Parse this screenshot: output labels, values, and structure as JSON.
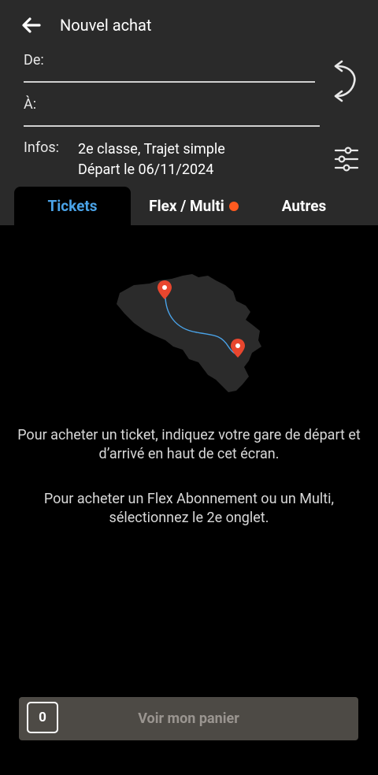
{
  "header": {
    "title": "Nouvel achat",
    "back_icon": "arrow-left-icon"
  },
  "form": {
    "from_label": "De:",
    "from_value": "",
    "to_label": "À:",
    "to_value": "",
    "swap_icon": "swap-direction-icon"
  },
  "infos": {
    "label": "Infos:",
    "line1": "2e classe, Trajet simple",
    "line2": "Départ le 06/11/2024",
    "filter_icon": "sliders-icon"
  },
  "tabs": [
    {
      "label": "Tickets",
      "active": true
    },
    {
      "label": "Flex / Multi",
      "badge": true
    },
    {
      "label": "Autres"
    }
  ],
  "main": {
    "map_icon": "belgium-route-map-icon",
    "message_1": "Pour acheter un ticket, indiquez votre gare de départ et d’arrivé en haut de cet écran.",
    "message_2": "Pour acheter un Flex Abonnement ou un Multi, sélectionnez le 2e onglet."
  },
  "cart": {
    "count": "0",
    "label": "Voir mon panier"
  },
  "colors": {
    "header_bg": "#2a2a2a",
    "active_tab": "#4aa3e8",
    "badge": "#ff5a1f",
    "pin": "#e8462e",
    "route": "#4aa3e8",
    "cart_bg": "#4d4a45"
  }
}
